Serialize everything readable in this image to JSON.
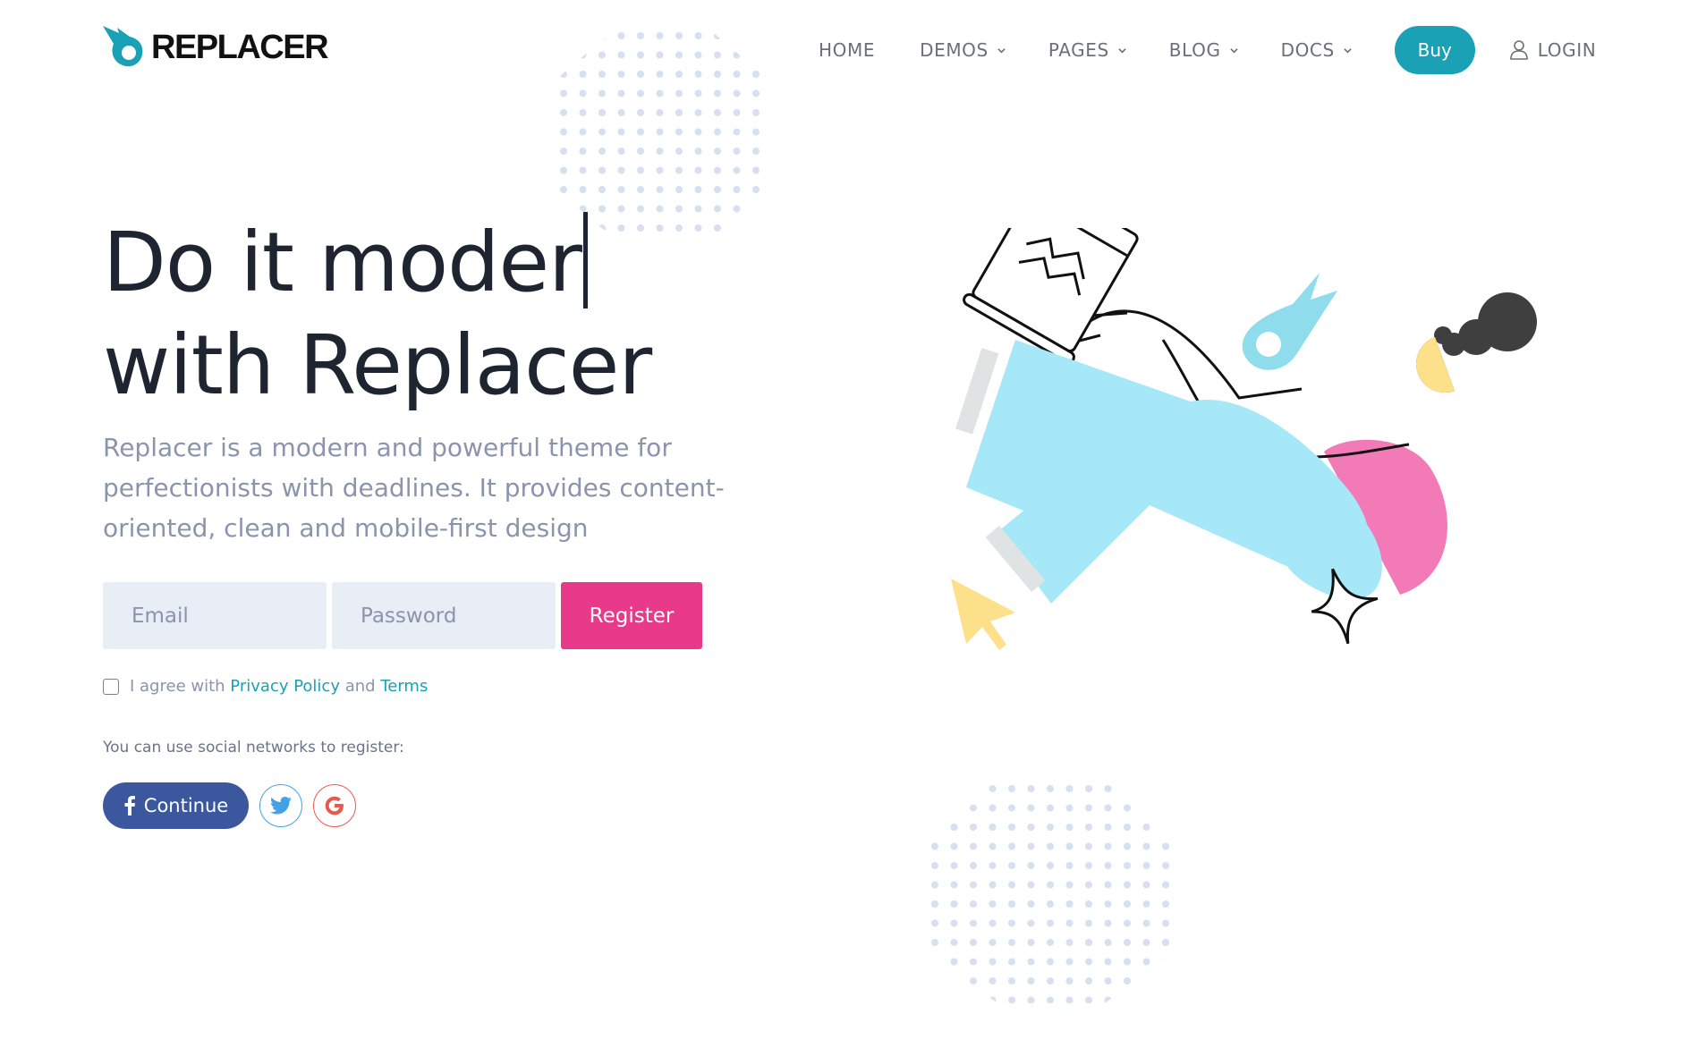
{
  "logo": {
    "text": "REPLACER"
  },
  "nav": {
    "items": [
      {
        "label": "HOME",
        "has_dropdown": false
      },
      {
        "label": "DEMOS",
        "has_dropdown": true
      },
      {
        "label": "PAGES",
        "has_dropdown": true
      },
      {
        "label": "BLOG",
        "has_dropdown": true
      },
      {
        "label": "DOCS",
        "has_dropdown": true
      }
    ],
    "buy_label": "Buy",
    "login_label": "LOGIN"
  },
  "hero": {
    "headline_line1": "Do it moder",
    "headline_line2": "with Replacer",
    "subtitle": "Replacer is a modern and powerful theme for perfectionists with deadlines. It provides content-oriented, clean and mobile-first design"
  },
  "form": {
    "email_placeholder": "Email",
    "password_placeholder": "Password",
    "register_label": "Register",
    "agree_prefix": "I agree with",
    "privacy_link": "Privacy Policy",
    "agree_and": "and",
    "terms_link": "Terms",
    "checkbox_checked": false
  },
  "social": {
    "note": "You can use social networks to register:",
    "facebook_label": "Continue",
    "twitter_icon": "twitter-icon",
    "google_icon": "google-icon"
  },
  "colors": {
    "accent": "#1ba1b5",
    "register": "#e8398b",
    "facebook": "#3b579d",
    "text_dark": "#1e2430",
    "text_muted": "#8a94ad",
    "field_bg": "#e8edf6",
    "dots": "#d6e0ef",
    "illustration_blue": "#a6e7f8",
    "illustration_pink": "#f27ab7",
    "illustration_yellow": "#fde08a",
    "illustration_dark": "#3f3f3f"
  }
}
